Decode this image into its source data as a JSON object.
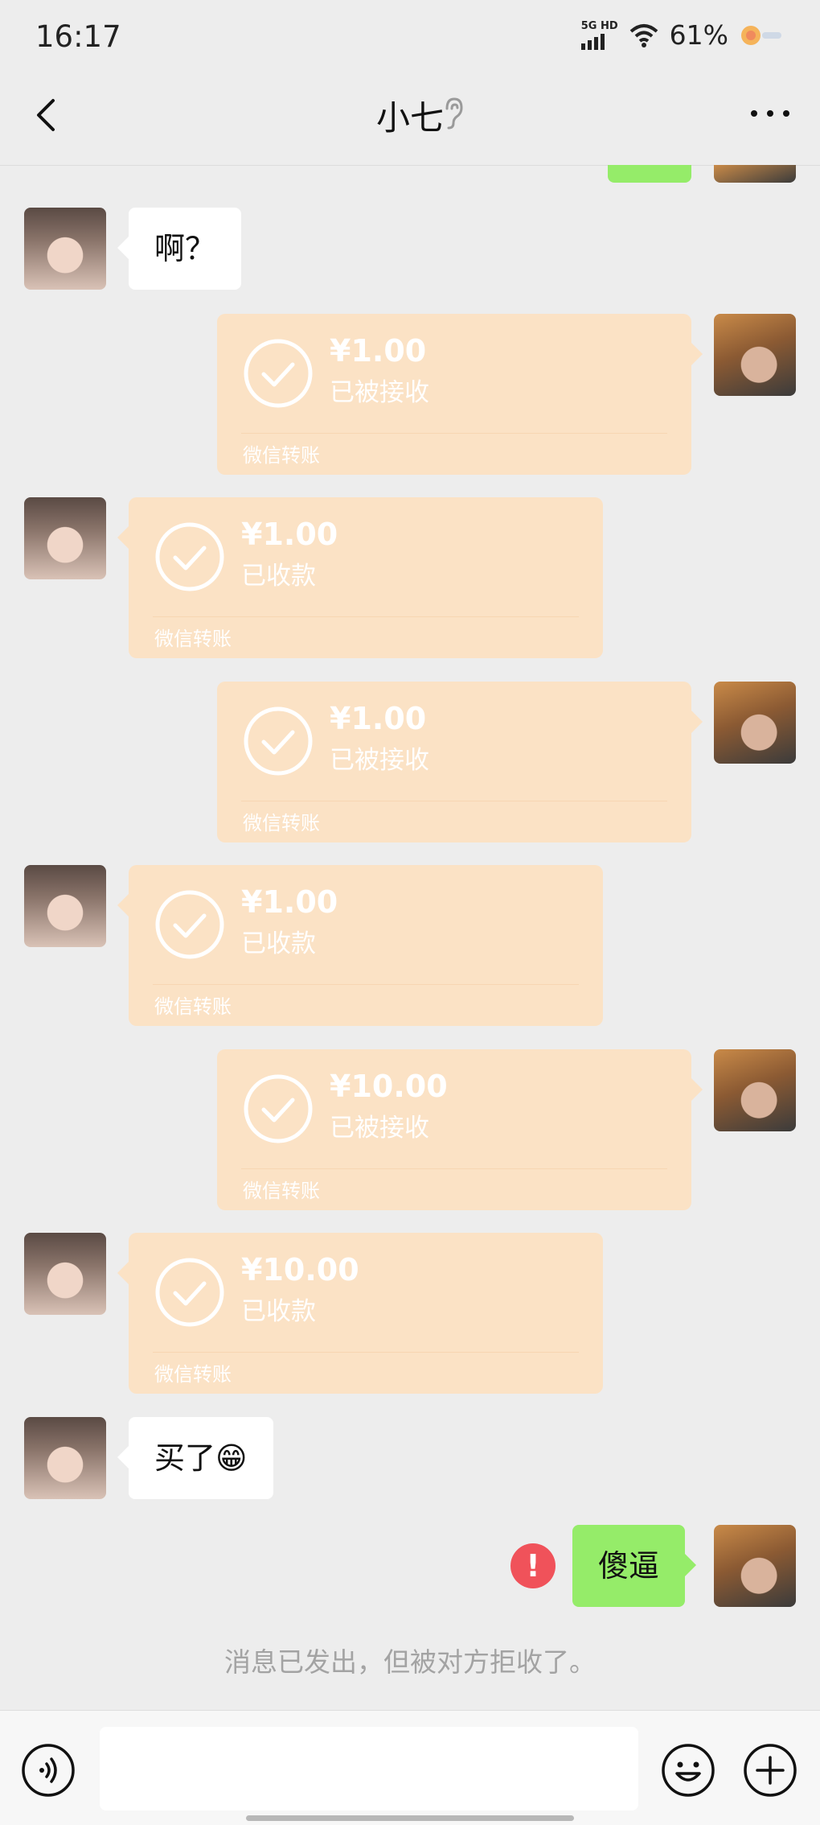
{
  "status_bar": {
    "time": "16:17",
    "network_top": "5G HD",
    "battery": "61%"
  },
  "header": {
    "title": "小七"
  },
  "messages": {
    "m1": {
      "text": "啊？"
    },
    "t1": {
      "amount": "¥1.00",
      "status": "已被接收",
      "footer": "微信转账"
    },
    "t2": {
      "amount": "¥1.00",
      "status": "已收款",
      "footer": "微信转账"
    },
    "t3": {
      "amount": "¥1.00",
      "status": "已被接收",
      "footer": "微信转账"
    },
    "t4": {
      "amount": "¥1.00",
      "status": "已收款",
      "footer": "微信转账"
    },
    "t5": {
      "amount": "¥10.00",
      "status": "已被接收",
      "footer": "微信转账"
    },
    "t6": {
      "amount": "¥10.00",
      "status": "已收款",
      "footer": "微信转账"
    },
    "m2": {
      "text": "买了😁"
    },
    "m3": {
      "text": "傻逼",
      "error_mark": "!"
    }
  },
  "system_notice": "消息已发出，但被对方拒收了。",
  "input_bar": {
    "value": "",
    "placeholder": ""
  },
  "colors": {
    "background": "#ededed",
    "sent_bubble": "#95ec69",
    "transfer_bubble": "#fbe2c5",
    "error": "#f0525a"
  },
  "icons": [
    "back-arrow-icon",
    "ear-icon",
    "more-icon",
    "voice-icon",
    "emoji-icon",
    "plus-icon",
    "check-circle-icon",
    "error-icon",
    "wifi-icon",
    "signal-icon",
    "battery-icon"
  ]
}
